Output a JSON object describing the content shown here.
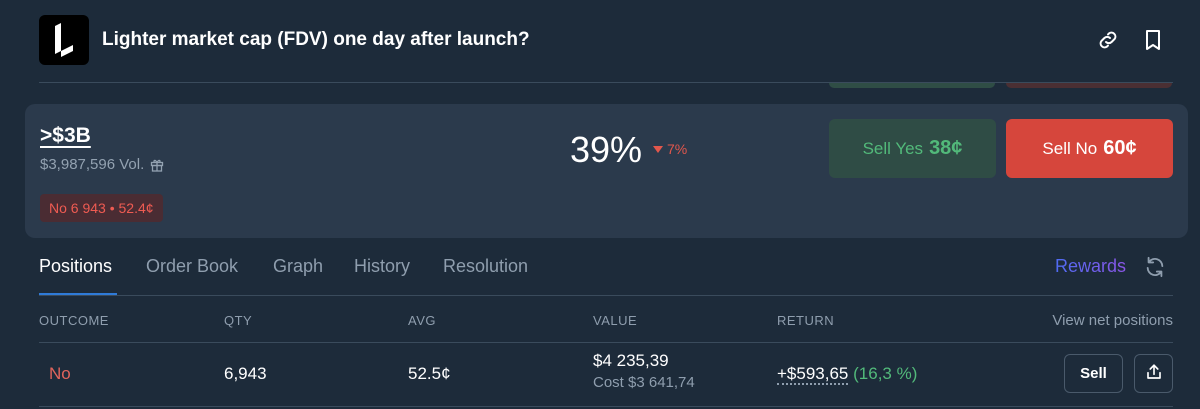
{
  "header": {
    "title": "Lighter market cap (FDV) one day after launch?",
    "logo": "lighter-logo",
    "icons": [
      "link-icon",
      "bookmark-icon"
    ]
  },
  "outcome": {
    "label": ">$3B",
    "volume": "$3,987,596 Vol.",
    "position": "No 6 943 • 52.4¢",
    "chance": "39%",
    "change": "7%",
    "change_direction": "down",
    "sell_yes_label": "Sell Yes",
    "sell_yes_price": "38¢",
    "sell_no_label": "Sell No",
    "sell_no_price": "60¢"
  },
  "tabs": {
    "items": [
      "Positions",
      "Order Book",
      "Graph",
      "History",
      "Resolution"
    ],
    "active": "Positions",
    "rewards": "Rewards"
  },
  "table": {
    "headers": [
      "OUTCOME",
      "QTY",
      "AVG",
      "VALUE",
      "RETURN"
    ],
    "view_net": "View net positions",
    "rows": [
      {
        "outcome": "No",
        "qty": "6,943",
        "avg": "52.5¢",
        "value": "$4 235,39",
        "cost": "Cost $3 641,74",
        "return": "+$593,65",
        "return_pct": "(16,3 %)",
        "sell_label": "Sell"
      }
    ]
  },
  "colors": {
    "background": "#1d2b3a",
    "card": "#2b3a4c",
    "green": "#52b97a",
    "red": "#d6463c",
    "accent_blue": "#2f7bd8"
  }
}
